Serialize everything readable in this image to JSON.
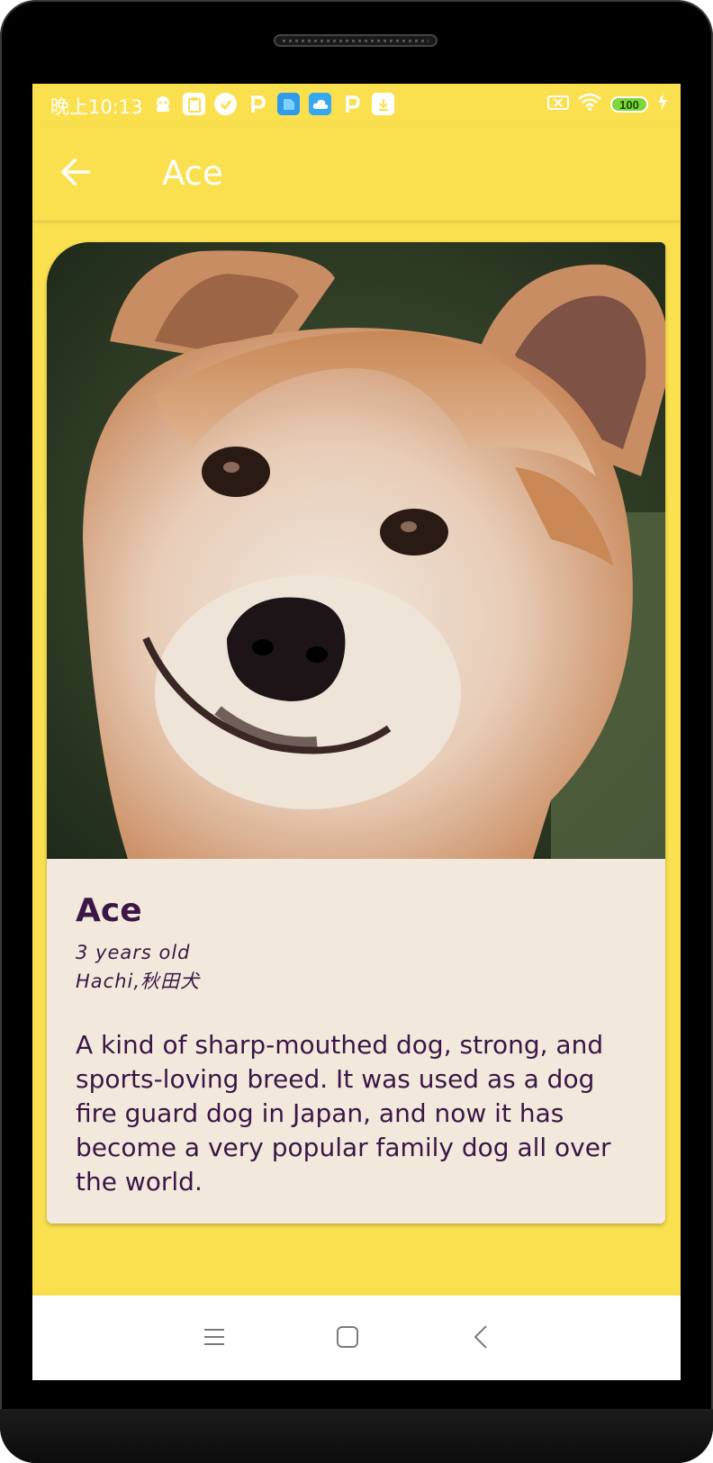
{
  "status_bar": {
    "time": "晚上10:13",
    "battery": "100",
    "icons": [
      "ghost-icon",
      "clipboard-icon",
      "check-icon",
      "p-icon",
      "file-icon",
      "cloud-icon",
      "p-icon",
      "download-icon"
    ]
  },
  "app_bar": {
    "title": "Ace",
    "back_icon": "arrow-left-icon"
  },
  "card": {
    "name": "Ace",
    "age": "3 years old",
    "breed": "Hachi,秋田犬",
    "description": "A kind of sharp-mouthed dog, strong, and sports-loving breed. It was used as a dog fire guard dog in Japan, and now it has become a very popular family dog all over the world.",
    "image_subject": "akita-dog-photo"
  },
  "nav_bar": {
    "items": [
      "menu-icon",
      "home-icon",
      "back-icon"
    ]
  },
  "colors": {
    "app_background": "#fae04f",
    "card_background": "#f2e9dc",
    "text_primary": "#3b1646"
  }
}
